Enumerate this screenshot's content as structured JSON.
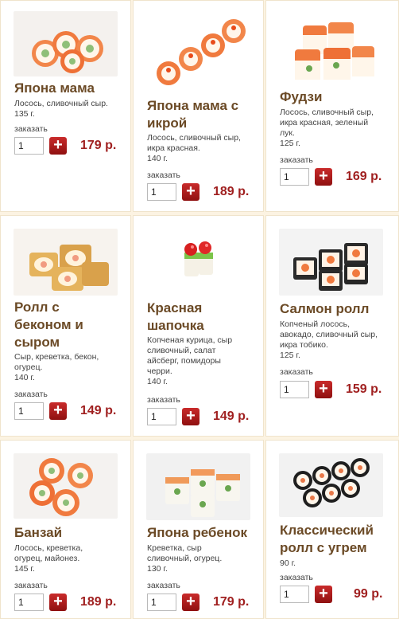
{
  "colors": {
    "background": "#fcf3e2",
    "card": "#ffffff",
    "title": "#6b4a26",
    "price": "#a02020",
    "add_button": "#b71c1c"
  },
  "order_label": "заказать",
  "products": [
    {
      "name": "Япона мама",
      "desc": "Лосось, сливочный сыр.\n135 г.",
      "qty": "1",
      "price": "179 р.",
      "image_icon": "salmon-roll-icon"
    },
    {
      "name": "Япона мама с\nикрой",
      "desc": "Лосось, сливочный сыр,\nикра красная.\n140 г.",
      "qty": "1",
      "price": "189 р.",
      "image_icon": "salmon-roll-roe-icon"
    },
    {
      "name": "Фудзи",
      "desc": "Лосось, сливочный сыр,\nикра красная, зеленый\nлук.\n125 г.",
      "qty": "1",
      "price": "169 р.",
      "image_icon": "fuji-roll-icon"
    },
    {
      "name": "Ролл с\nбеконом и\nсыром",
      "desc": "Сыр, креветка, бекон,\nогурец.\n140 г.",
      "qty": "1",
      "price": "149 р.",
      "image_icon": "bacon-roll-icon"
    },
    {
      "name": "Красная\nшапочка",
      "desc": "Копченая курица, сыр\nсливочный, салат\nайсберг, помидоры\nчерри.\n140 г.",
      "qty": "1",
      "price": "149 р.",
      "image_icon": "tomato-roll-icon"
    },
    {
      "name": "Салмон ролл",
      "desc": "Копченый лосось,\nавокадо, сливочный сыр,\nикра тобико.\n125 г.",
      "qty": "1",
      "price": "159 р.",
      "image_icon": "salmon-tobiko-roll-icon"
    },
    {
      "name": "Банзай",
      "desc": "Лосось, креветка,\nогурец, майонез.\n145 г.",
      "qty": "1",
      "price": "189 р.",
      "image_icon": "banzai-roll-icon"
    },
    {
      "name": "Япона ребенок",
      "desc": "Креветка, сыр\nсливочный, огурец.\n130 г.",
      "qty": "1",
      "price": "179 р.",
      "image_icon": "shrimp-roll-icon"
    },
    {
      "name": "Классический\nролл с угрем",
      "desc": "90 г.",
      "qty": "1",
      "price": "99 р.",
      "image_icon": "eel-roll-icon"
    }
  ]
}
